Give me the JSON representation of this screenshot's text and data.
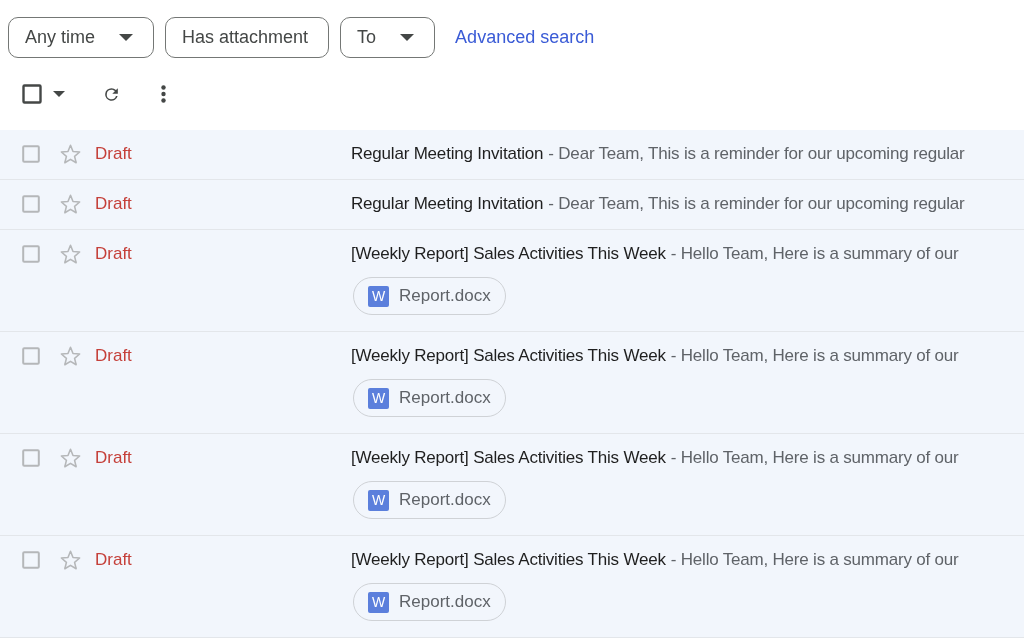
{
  "filters": [
    {
      "label": "Any time",
      "dropdown": true
    },
    {
      "label": "Has attachment",
      "dropdown": false
    },
    {
      "label": "To",
      "dropdown": true
    }
  ],
  "advanced_search": "Advanced search",
  "toolbar": {
    "select_all_checked": false
  },
  "messages": [
    {
      "checked": false,
      "starred": false,
      "sender": "Draft",
      "subject": "Regular Meeting Invitation",
      "snippet": "- Dear Team, This is a reminder for our upcoming regular"
    },
    {
      "checked": false,
      "starred": false,
      "sender": "Draft",
      "subject": "Regular Meeting Invitation",
      "snippet": "- Dear Team, This is a reminder for our upcoming regular"
    },
    {
      "checked": false,
      "starred": false,
      "sender": "Draft",
      "subject": "[Weekly Report] Sales Activities This Week",
      "snippet": "- Hello Team, Here is a summary of our",
      "attachments": [
        {
          "icon_letter": "W",
          "name": "Report.docx"
        }
      ]
    },
    {
      "checked": false,
      "starred": false,
      "sender": "Draft",
      "subject": "[Weekly Report] Sales Activities This Week",
      "snippet": "- Hello Team, Here is a summary of our",
      "attachments": [
        {
          "icon_letter": "W",
          "name": "Report.docx"
        }
      ]
    },
    {
      "checked": false,
      "starred": false,
      "sender": "Draft",
      "subject": "[Weekly Report] Sales Activities This Week",
      "snippet": "- Hello Team, Here is a summary of our",
      "attachments": [
        {
          "icon_letter": "W",
          "name": "Report.docx"
        }
      ]
    },
    {
      "checked": false,
      "starred": false,
      "sender": "Draft",
      "subject": "[Weekly Report] Sales Activities This Week",
      "snippet": "- Hello Team, Here is a summary of our",
      "attachments": [
        {
          "icon_letter": "W",
          "name": "Report.docx"
        }
      ]
    }
  ]
}
